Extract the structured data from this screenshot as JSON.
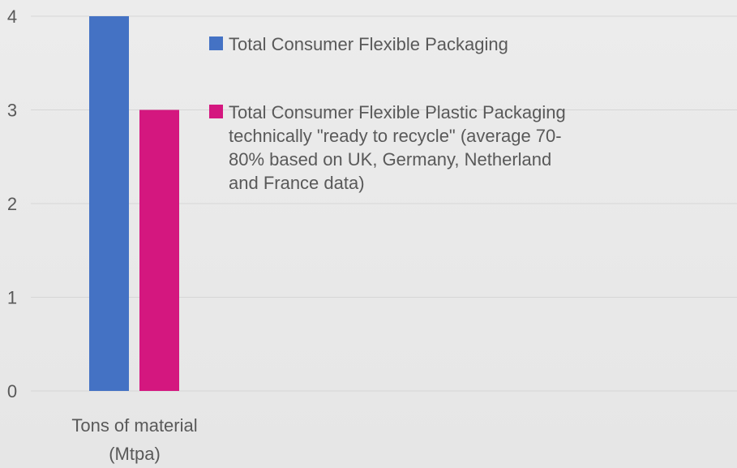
{
  "chart_data": {
    "type": "bar",
    "categories": [
      "Tons of material\n(Mtpa)"
    ],
    "category_lines": [
      "Tons of material",
      "(Mtpa)"
    ],
    "series": [
      {
        "name": "Total Consumer Flexible Packaging",
        "values": [
          4
        ],
        "color": "#4472c4"
      },
      {
        "name": "Total Consumer Flexible Plastic Packaging technically \"ready to recycle\" (average 70-80% based on UK, Germany, Netherland and France data)",
        "values": [
          3
        ],
        "color": "#d4177f"
      }
    ],
    "ylim": [
      0,
      4
    ],
    "yticks": [
      0,
      1,
      2,
      3,
      4
    ],
    "grid": true,
    "legend_position": "right",
    "title": "",
    "xlabel": "",
    "ylabel": ""
  }
}
